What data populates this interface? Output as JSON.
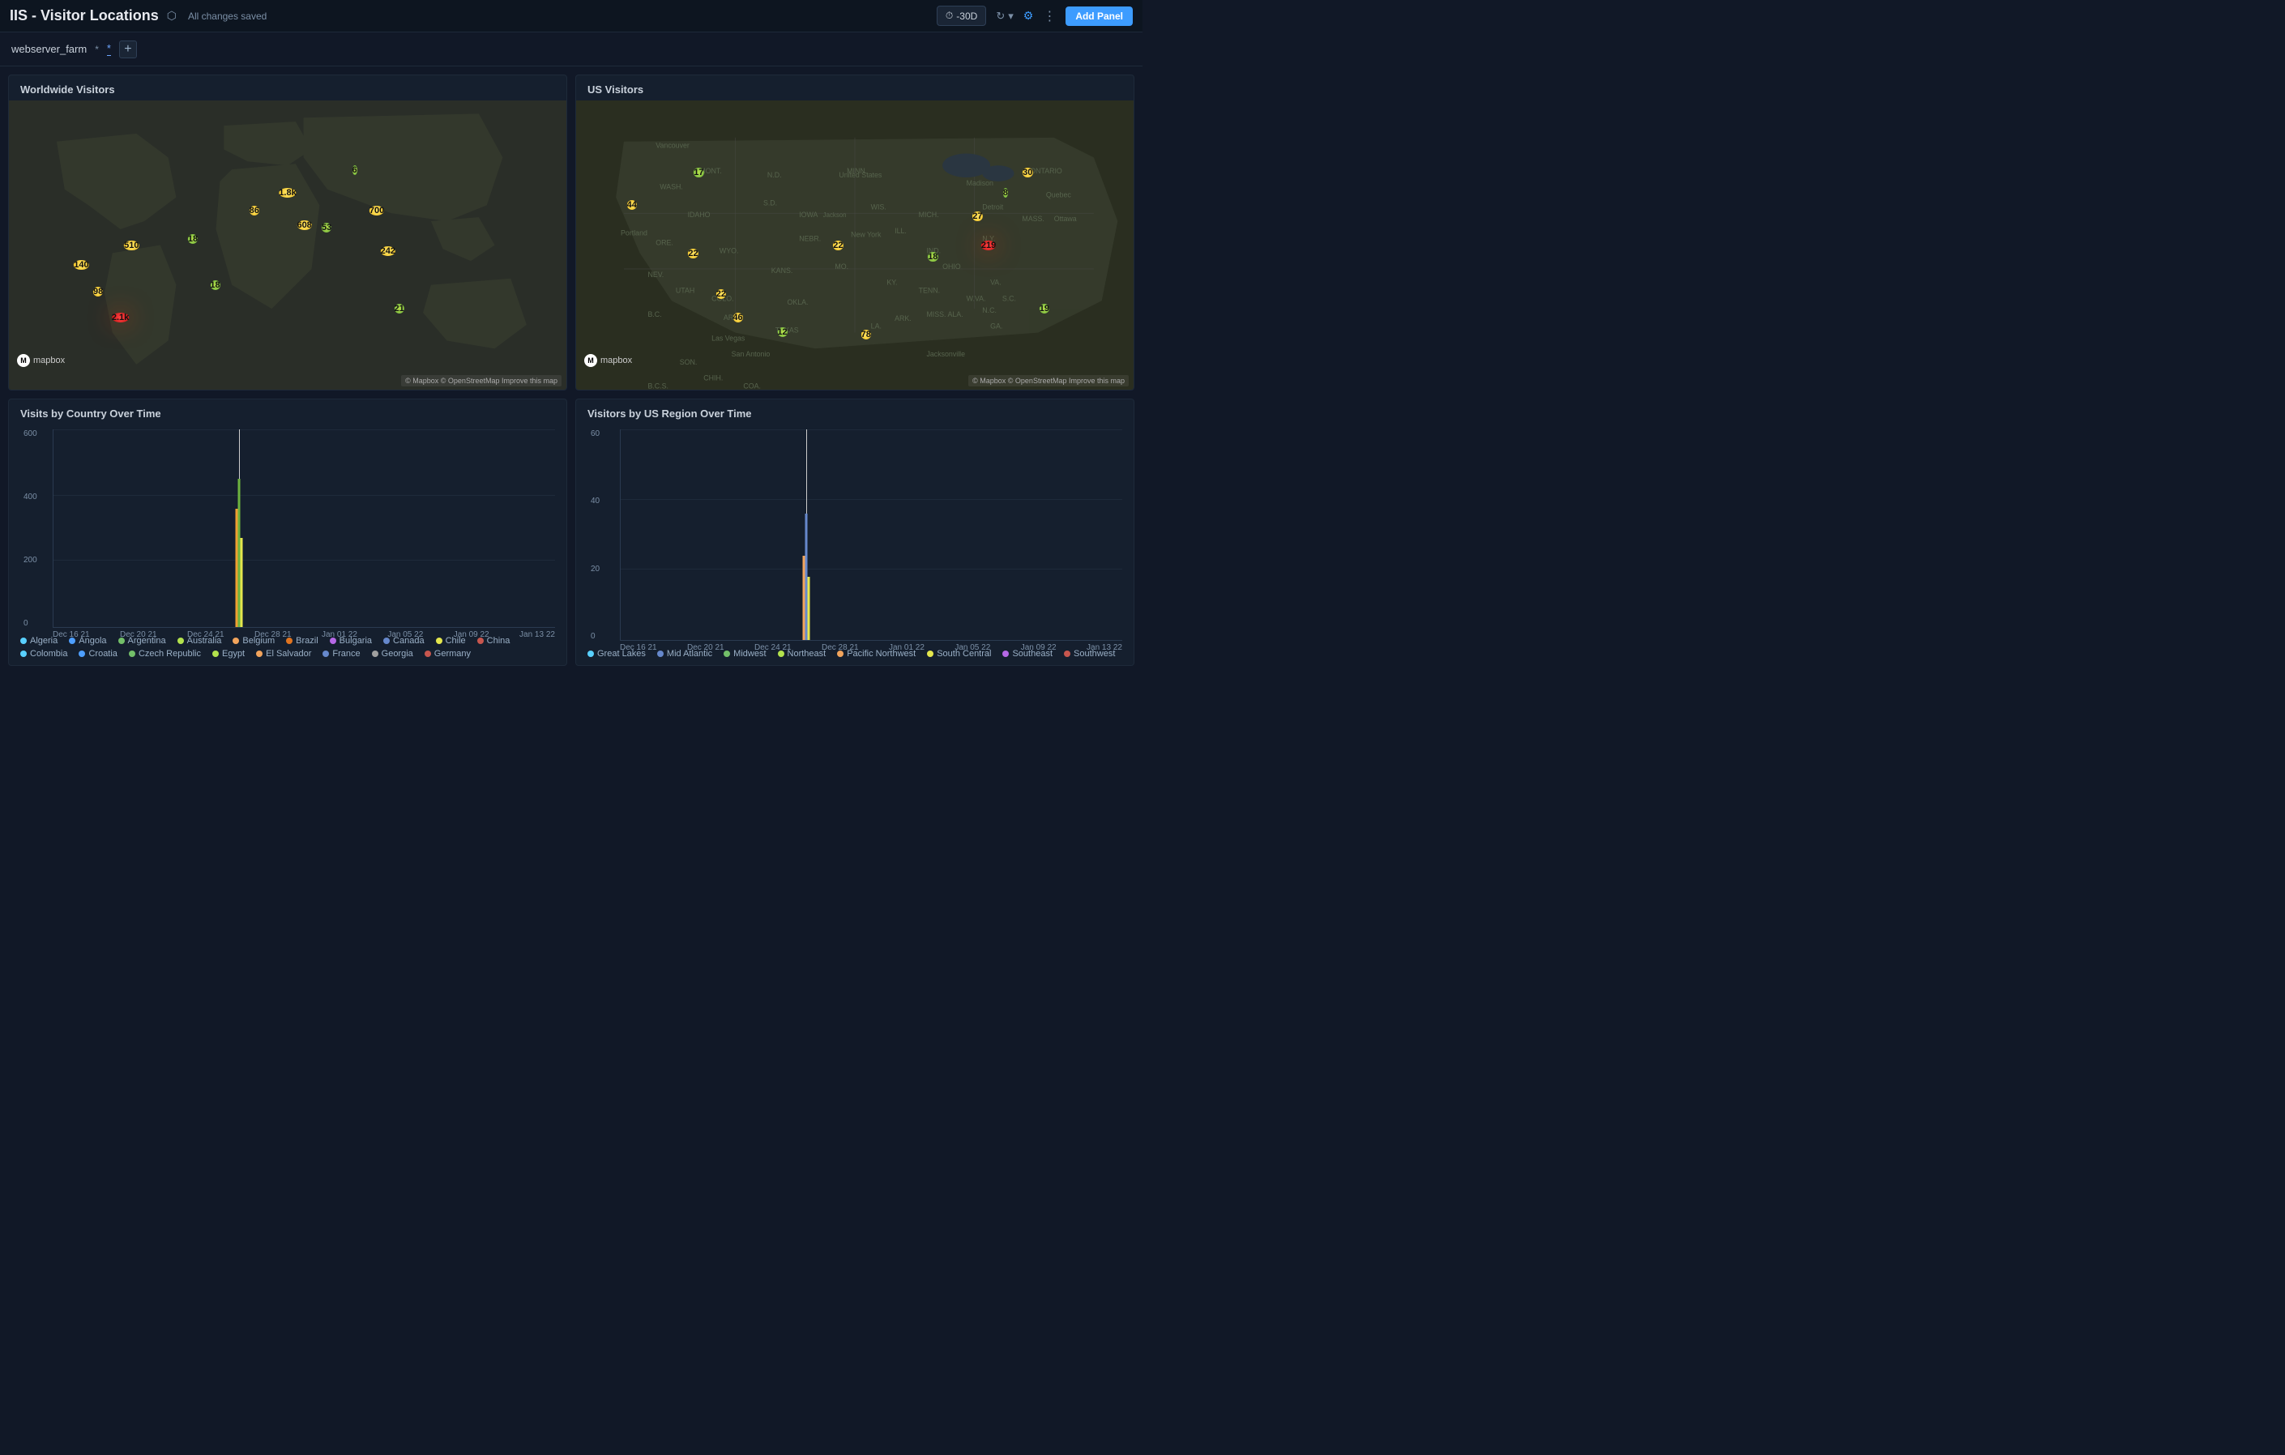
{
  "header": {
    "title": "IIS - Visitor Locations",
    "share_label": "share",
    "saved_text": "All changes saved",
    "time_range": "-30D",
    "add_panel_label": "Add Panel"
  },
  "subheader": {
    "variable_name": "webserver_farm",
    "variable_value": "*",
    "add_btn_label": "+"
  },
  "panels": {
    "worldwide": {
      "title": "Worldwide Visitors",
      "mapbox_label": "mapbox",
      "attribution": "© Mapbox © OpenStreetMap Improve this map"
    },
    "us_visitors": {
      "title": "US Visitors",
      "mapbox_label": "mapbox",
      "attribution": "© Mapbox © OpenStreetMap Improve this map"
    },
    "country_chart": {
      "title": "Visits by Country Over Time",
      "y_labels": [
        "600",
        "400",
        "200",
        "0"
      ],
      "x_labels": [
        "Dec 16 21",
        "Dec 20 21",
        "Dec 24 21",
        "Dec 28 21",
        "Jan 01 22",
        "Jan 05 22",
        "Jan 09 22",
        "Jan 13 22"
      ],
      "legend": [
        {
          "label": "Algeria",
          "color": "#59d0ff"
        },
        {
          "label": "Angola",
          "color": "#4e9fff"
        },
        {
          "label": "Argentina",
          "color": "#73bf69"
        },
        {
          "label": "Australia",
          "color": "#b3e24d"
        },
        {
          "label": "Belgium",
          "color": "#f2a45c"
        },
        {
          "label": "Brazil",
          "color": "#e07420"
        },
        {
          "label": "Bulgaria",
          "color": "#b668e6"
        },
        {
          "label": "Canada",
          "color": "#6688cc"
        },
        {
          "label": "Chile",
          "color": "#e4e64d"
        },
        {
          "label": "China",
          "color": "#c7564e"
        },
        {
          "label": "Colombia",
          "color": "#59d0ff"
        },
        {
          "label": "Croatia",
          "color": "#4e9fff"
        },
        {
          "label": "Czech Republic",
          "color": "#73bf69"
        },
        {
          "label": "Egypt",
          "color": "#b3e24d"
        },
        {
          "label": "El Salvador",
          "color": "#f2a45c"
        },
        {
          "label": "France",
          "color": "#6688cc"
        },
        {
          "label": "Georgia",
          "color": "#a0a0a0"
        },
        {
          "label": "Germany",
          "color": "#c7564e"
        }
      ]
    },
    "us_region_chart": {
      "title": "Visitors by US Region Over Time",
      "y_labels": [
        "60",
        "40",
        "20",
        "0"
      ],
      "x_labels": [
        "Dec 16 21",
        "Dec 20 21",
        "Dec 24 21",
        "Dec 28 21",
        "Jan 01 22",
        "Jan 05 22",
        "Jan 09 22",
        "Jan 13 22"
      ],
      "legend": [
        {
          "label": "Great Lakes",
          "color": "#59d0ff"
        },
        {
          "label": "Mid Atlantic",
          "color": "#6688cc"
        },
        {
          "label": "Midwest",
          "color": "#73bf69"
        },
        {
          "label": "Northeast",
          "color": "#b3e24d"
        },
        {
          "label": "Pacific Northwest",
          "color": "#f2a45c"
        },
        {
          "label": "South Central",
          "color": "#e4e64d"
        },
        {
          "label": "Southeast",
          "color": "#b668e6"
        },
        {
          "label": "Southwest",
          "color": "#c7564e"
        }
      ]
    }
  },
  "world_bubbles": [
    {
      "x": 13,
      "y": 57,
      "label": "140",
      "size": "md",
      "color": "b-yellow"
    },
    {
      "x": 22,
      "y": 50,
      "label": "510",
      "size": "lg",
      "color": "b-yellow"
    },
    {
      "x": 16,
      "y": 66,
      "label": "98",
      "size": "md",
      "color": "b-yellow"
    },
    {
      "x": 20,
      "y": 75,
      "label": "2.1k",
      "size": "xxl",
      "color": "b-red"
    },
    {
      "x": 33,
      "y": 48,
      "label": "18",
      "size": "sm",
      "color": "b-green"
    },
    {
      "x": 37,
      "y": 64,
      "label": "18",
      "size": "sm",
      "color": "b-green"
    },
    {
      "x": 44,
      "y": 38,
      "label": "86",
      "size": "md",
      "color": "b-yellow"
    },
    {
      "x": 50,
      "y": 32,
      "label": "1.8k",
      "size": "xl",
      "color": "b-yellow"
    },
    {
      "x": 53,
      "y": 43,
      "label": "608",
      "size": "lg",
      "color": "b-yellow"
    },
    {
      "x": 57,
      "y": 44,
      "label": "53",
      "size": "sm",
      "color": "b-green"
    },
    {
      "x": 62,
      "y": 24,
      "label": "6",
      "size": "sm",
      "color": "b-green"
    },
    {
      "x": 66,
      "y": 38,
      "label": "700",
      "size": "lg",
      "color": "b-yellow"
    },
    {
      "x": 68,
      "y": 52,
      "label": "242",
      "size": "md",
      "color": "b-yellow"
    },
    {
      "x": 70,
      "y": 72,
      "label": "21",
      "size": "sm",
      "color": "b-green"
    }
  ],
  "us_bubbles": [
    {
      "x": 10,
      "y": 36,
      "label": "44",
      "size": "md",
      "color": "b-yellow"
    },
    {
      "x": 22,
      "y": 25,
      "label": "17",
      "size": "sm",
      "color": "b-green"
    },
    {
      "x": 21,
      "y": 53,
      "label": "22",
      "size": "md",
      "color": "b-yellow"
    },
    {
      "x": 26,
      "y": 67,
      "label": "22",
      "size": "md",
      "color": "b-yellow"
    },
    {
      "x": 29,
      "y": 75,
      "label": "46",
      "size": "md",
      "color": "b-yellow"
    },
    {
      "x": 37,
      "y": 80,
      "label": "12",
      "size": "sm",
      "color": "b-green"
    },
    {
      "x": 47,
      "y": 50,
      "label": "22",
      "size": "md",
      "color": "b-yellow"
    },
    {
      "x": 52,
      "y": 81,
      "label": "78",
      "size": "md",
      "color": "b-yellow"
    },
    {
      "x": 64,
      "y": 54,
      "label": "18",
      "size": "sm",
      "color": "b-green"
    },
    {
      "x": 72,
      "y": 40,
      "label": "27",
      "size": "md",
      "color": "b-yellow"
    },
    {
      "x": 74,
      "y": 50,
      "label": "219",
      "size": "xl",
      "color": "b-red"
    },
    {
      "x": 77,
      "y": 32,
      "label": "8",
      "size": "sm",
      "color": "b-green"
    },
    {
      "x": 81,
      "y": 25,
      "label": "30",
      "size": "md",
      "color": "b-yellow"
    },
    {
      "x": 84,
      "y": 72,
      "label": "19",
      "size": "sm",
      "color": "b-green"
    }
  ]
}
